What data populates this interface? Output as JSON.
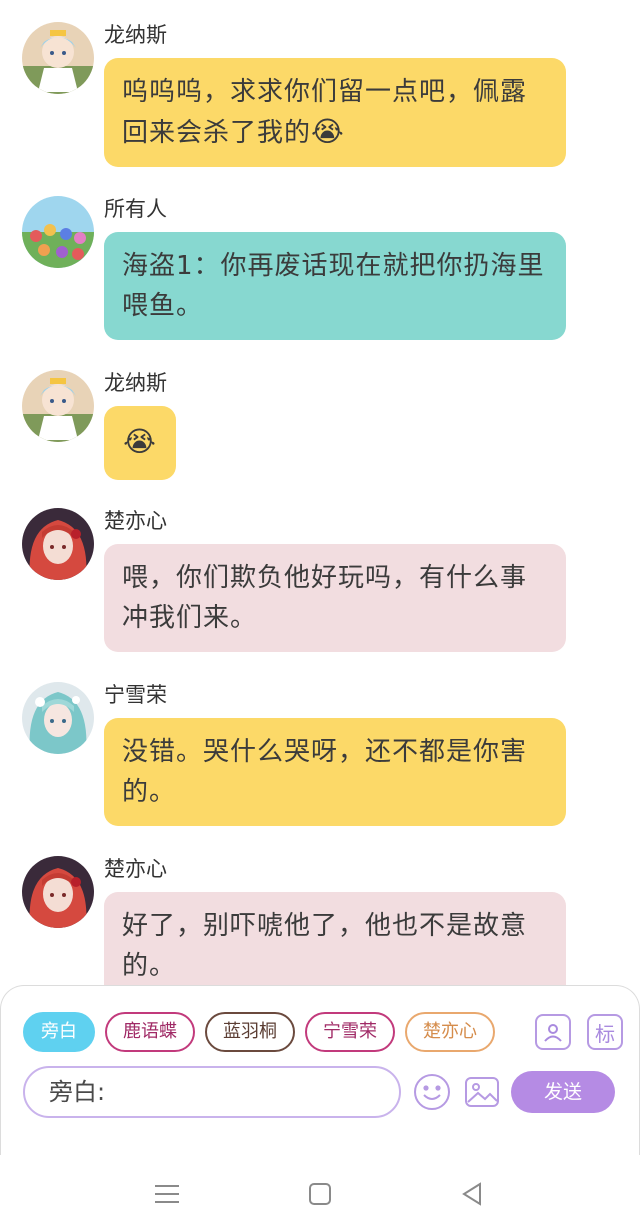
{
  "messages": [
    {
      "sender": "龙纳斯",
      "text": "呜呜呜，求求你们留一点吧，佩露回来会杀了我的",
      "emoji": "😭",
      "color": "yellow",
      "avatar": "chibi-character-avatar"
    },
    {
      "sender": "所有人",
      "text": "海盗1：你再废话现在就把你扔海里喂鱼。",
      "emoji": "",
      "color": "teal",
      "avatar": "group-crowd-avatar"
    },
    {
      "sender": "龙纳斯",
      "text": "",
      "emoji": "😭",
      "color": "yellow",
      "avatar": "chibi-character-avatar"
    },
    {
      "sender": "楚亦心",
      "text": "喂，你们欺负他好玩吗，有什么事冲我们来。",
      "emoji": "",
      "color": "pink",
      "avatar": "red-hair-girl-avatar"
    },
    {
      "sender": "宁雪荣",
      "text": "没错。哭什么哭呀，还不都是你害的。",
      "emoji": "",
      "color": "yellow",
      "avatar": "teal-hair-girl-avatar"
    },
    {
      "sender": "楚亦心",
      "text": "好了，别吓唬他了，他也不是故意的。",
      "emoji": "",
      "color": "pink",
      "avatar": "red-hair-girl-avatar"
    }
  ],
  "composer": {
    "chips": [
      {
        "label": "旁白",
        "active": true
      },
      {
        "label": "鹿语蝶",
        "active": false
      },
      {
        "label": "蓝羽桐",
        "active": false
      },
      {
        "label": "宁雪荣",
        "active": false
      },
      {
        "label": "楚亦心",
        "active": false
      }
    ],
    "tag_button": "标",
    "input_value": "旁白:",
    "send_label": "发送"
  },
  "icons": {
    "character": "person-card-icon",
    "tag": "tag-icon",
    "emoji": "smiley-icon",
    "image": "image-icon",
    "nav_menu": "menu-icon",
    "nav_home": "square-home-icon",
    "nav_back": "triangle-back-icon"
  },
  "colors": {
    "yellow_bubble": "#fcd968",
    "teal_bubble": "#87d8d0",
    "pink_bubble": "#f2dde0",
    "send_button": "#b58be4",
    "active_chip": "#5fd1f0"
  }
}
